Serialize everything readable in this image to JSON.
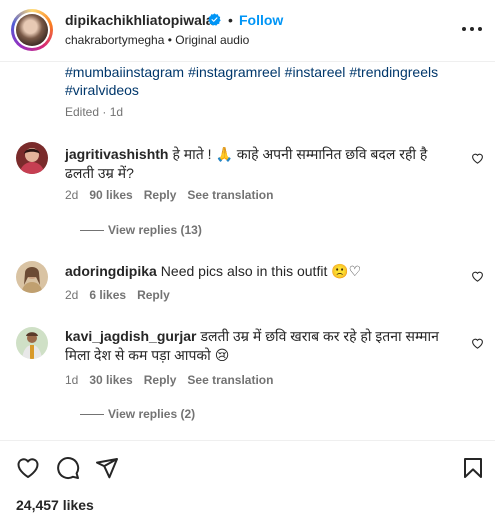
{
  "header": {
    "username": "dipikachikhliatopiwala",
    "separator": "•",
    "follow_label": "Follow",
    "subtitle": "chakrabortymegha • Original audio"
  },
  "caption": {
    "hashtags": [
      "#mumbaiinstagram",
      "#instagramreel",
      "#instareel",
      "#trendingreels",
      "#viralvideos"
    ],
    "edited": "Edited · 1d"
  },
  "comments": [
    {
      "username": "jagritivashishth",
      "text": "हे माते ! 🙏 काहे अपनी सम्मानित छवि बदल रही है ढलती उम्र में?",
      "age": "2d",
      "likes": "90 likes",
      "reply": "Reply",
      "translate": "See translation",
      "view_replies": "View replies (13)"
    },
    {
      "username": "adoringdipika",
      "text": "Need pics also in this outfit 🙁♡",
      "age": "2d",
      "likes": "6 likes",
      "reply": "Reply"
    },
    {
      "username": "kavi_jagdish_gurjar",
      "text": "डलती उम्र में छवि खराब कर रहे हो इतना सम्मान मिला देश से कम पड़ा आपको 😢",
      "age": "1d",
      "likes": "30 likes",
      "reply": "Reply",
      "translate": "See translation",
      "view_replies": "View replies (2)"
    }
  ],
  "footer": {
    "likes": "24,457 likes"
  },
  "colors": {
    "link": "#00376b",
    "follow": "#0095f6",
    "secondary": "#737373",
    "verified": "#0095f6"
  },
  "icons": [
    "verified-badge-icon",
    "more-options-icon",
    "heart-icon",
    "comment-icon",
    "share-icon",
    "save-icon"
  ]
}
